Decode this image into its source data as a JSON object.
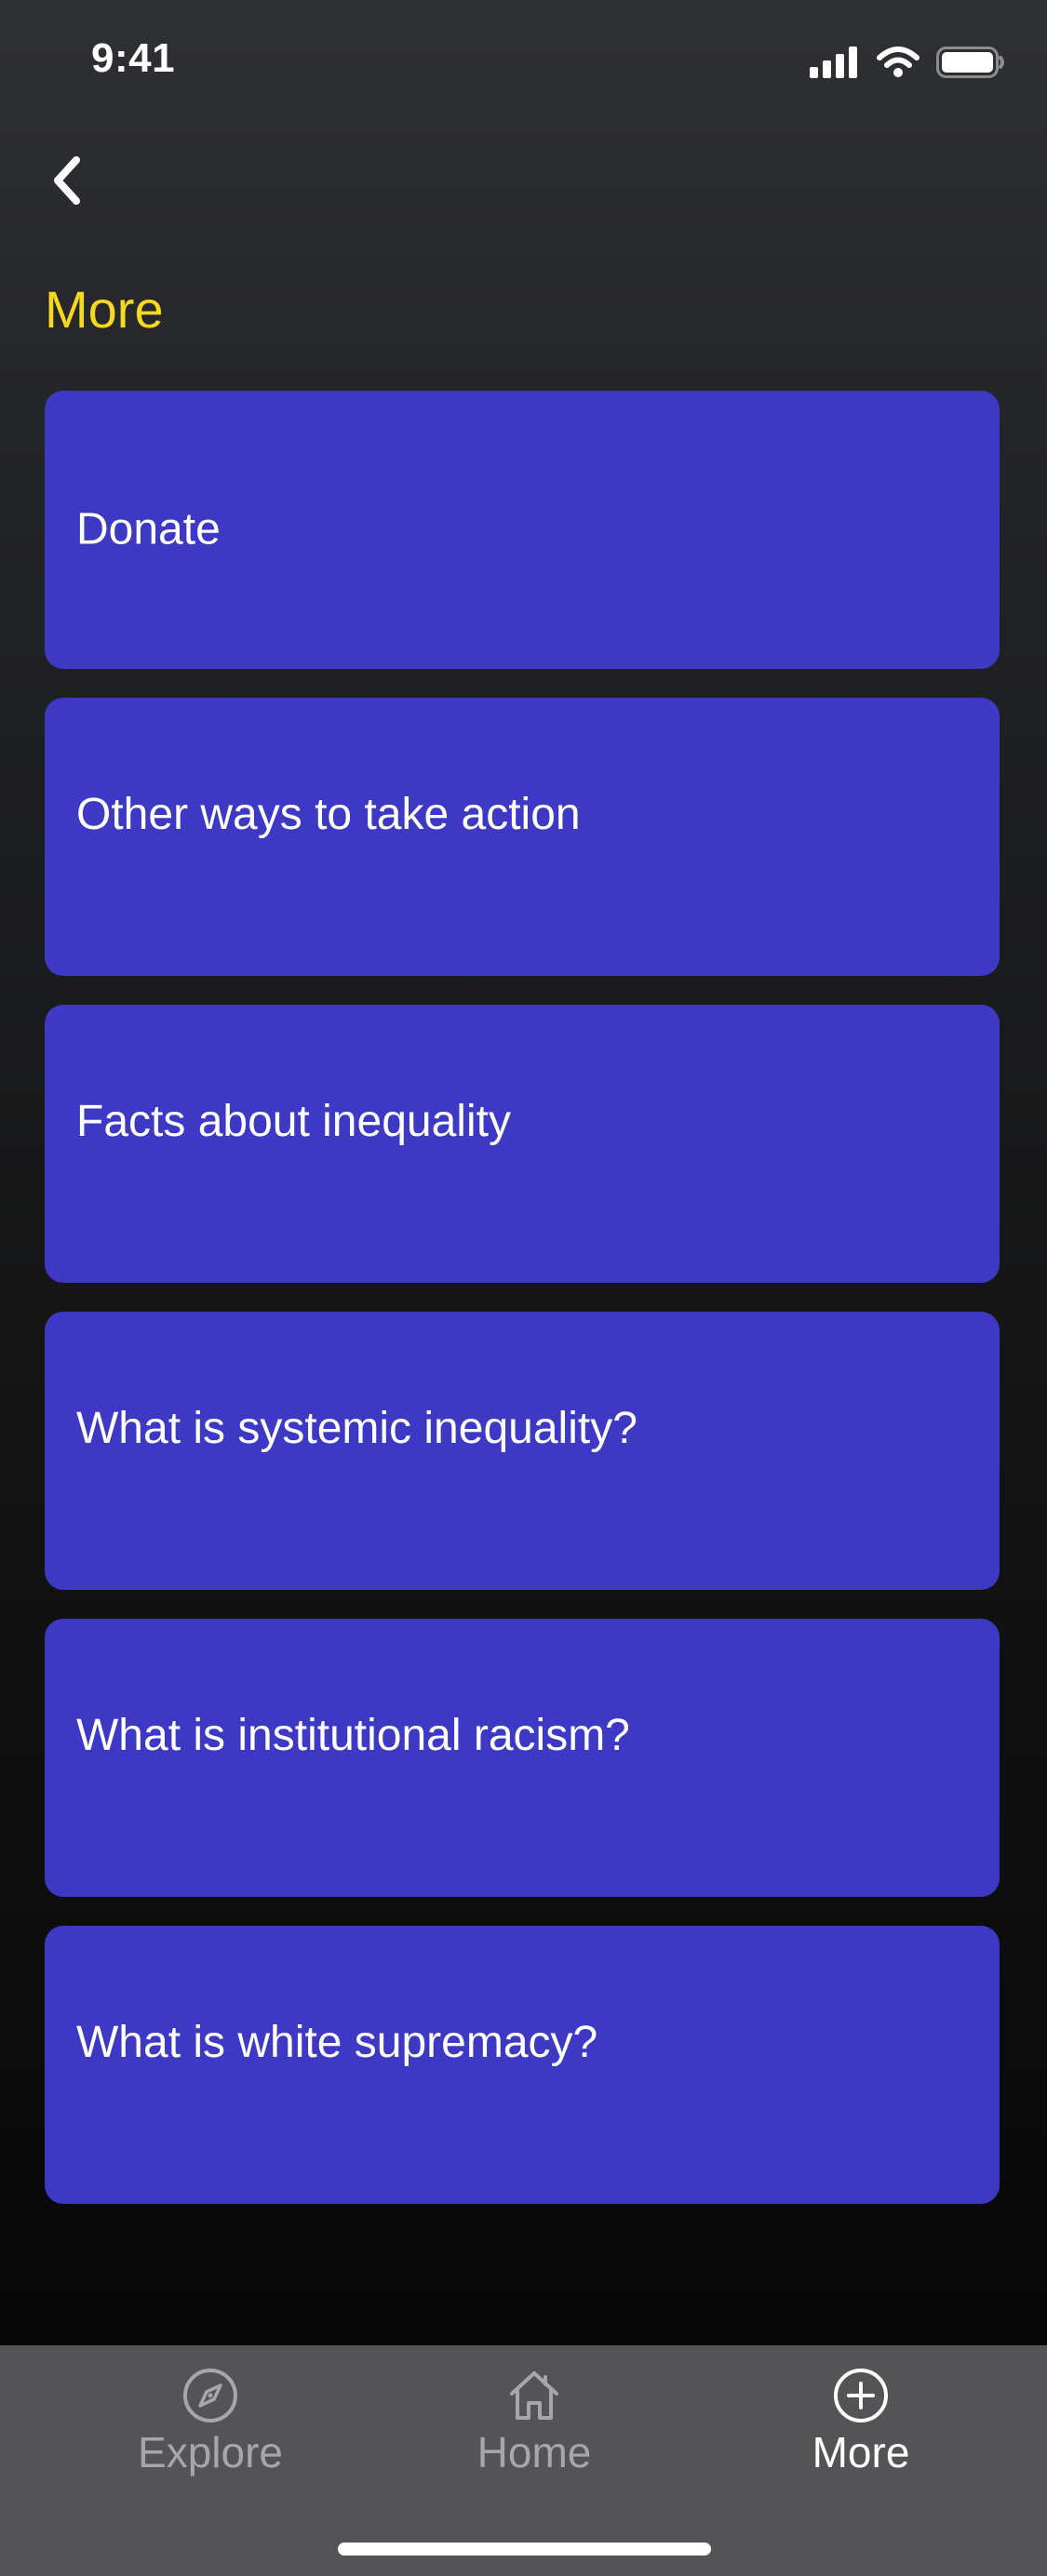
{
  "status_bar": {
    "time": "9:41",
    "icons": [
      "signal-bars-icon",
      "wifi-icon",
      "battery-icon"
    ]
  },
  "header": {
    "back_icon": "chevron-left-icon",
    "title": "More"
  },
  "menu": {
    "items": [
      {
        "label": "Donate"
      },
      {
        "label": "Other ways to take action"
      },
      {
        "label": "Facts about inequality"
      },
      {
        "label": "What is systemic inequality?"
      },
      {
        "label": "What is institutional racism?"
      },
      {
        "label": "What is white supremacy?"
      }
    ]
  },
  "tab_bar": {
    "tabs": [
      {
        "label": "Explore",
        "icon": "compass-icon",
        "active": false
      },
      {
        "label": "Home",
        "icon": "home-icon",
        "active": false
      },
      {
        "label": "More",
        "icon": "plus-circle-icon",
        "active": true
      }
    ]
  },
  "colors": {
    "title": "#f4d91f",
    "card": "#3d39c4",
    "tab_bar": "#545456",
    "tab_inactive": "#a7a7a9",
    "tab_active": "#ffffff"
  }
}
